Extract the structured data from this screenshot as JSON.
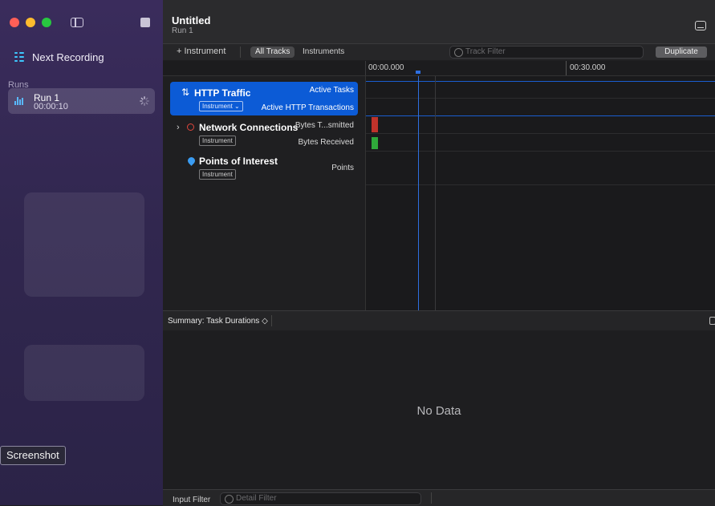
{
  "sidebar": {
    "next_recording_label": "Next Recording",
    "runs_label": "Runs",
    "run": {
      "name": "Run 1",
      "time": "00:00:10"
    },
    "tooltip": "Screenshot"
  },
  "window": {
    "title": "Untitled",
    "subtitle": "Run 1"
  },
  "toolbar": {
    "add_instrument": "+ Instrument",
    "all_tracks": "All Tracks",
    "instruments": "Instruments",
    "track_filter_placeholder": "Track Filter",
    "duplicate": "Duplicate"
  },
  "timeline": {
    "tick_labels": [
      "00:00.000",
      "00:30.000"
    ]
  },
  "tracks": [
    {
      "name": "HTTP Traffic",
      "badge": "Instrument ⌄",
      "lanes": [
        "Active Tasks",
        "Active HTTP Transactions"
      ],
      "selected": true
    },
    {
      "name": "Network Connections",
      "badge": "Instrument",
      "lanes": [
        "Bytes T...smitted",
        "Bytes Received"
      ],
      "selected": false
    },
    {
      "name": "Points of Interest",
      "badge": "Instrument",
      "lanes": [
        "Points"
      ],
      "selected": false
    }
  ],
  "summary": {
    "label": "Summary: Task Durations ◇",
    "empty_text": "No Data"
  },
  "bottom": {
    "input_filter": "Input Filter",
    "detail_filter_placeholder": "Detail Filter"
  },
  "colors": {
    "accent": "#0c5bd6",
    "sidebar_bg": "#332854",
    "close": "#ff5f57",
    "minimize": "#febc2e",
    "zoom": "#28c840",
    "bytes_transmitted": "#c0332b",
    "bytes_received": "#2fa83a"
  }
}
